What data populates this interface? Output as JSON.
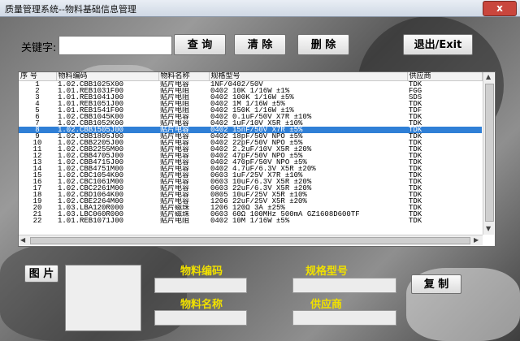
{
  "window": {
    "title": "质量管理系统--物料基础信息管理",
    "close": "x"
  },
  "search": {
    "label": "关键字:",
    "value": ""
  },
  "buttons": {
    "search": "查 询",
    "clear": "清 除",
    "delete": "删 除",
    "exit": "退出/Exit",
    "photo": "图 片",
    "copy": "复 制"
  },
  "table": {
    "headers": [
      "序 号",
      "物料编码",
      "物料名称",
      "规格型号",
      "供应商"
    ],
    "selected_index": 7,
    "rows": [
      [
        "1",
        "1.02.CBB1025X00",
        "贴片电容",
        "1NF/0402/50V",
        "TDK"
      ],
      [
        "2",
        "1.01.REB1031F00",
        "贴片电阻",
        "0402 10K 1/16W ±1%",
        "FGG"
      ],
      [
        "3",
        "1.01.REB1041J00",
        "贴片电阻",
        "0402 100K 1/16W ±5%",
        "SDS"
      ],
      [
        "4",
        "1.01.REB1051J00",
        "贴片电阻",
        "0402 1M 1/16W ±5%",
        "TDK"
      ],
      [
        "5",
        "1.01.REB1541F00",
        "贴片电阻",
        "0402 150K 1/16W ±1%",
        "TDF"
      ],
      [
        "6",
        "1.02.CBB1045K00",
        "贴片电容",
        "0402 0.1uF/50V X7R ±10%",
        "TDK"
      ],
      [
        "7",
        "1.02.CBB1052K00",
        "贴片电容",
        "0402 1uF/10V X5R ±10%",
        "TDK"
      ],
      [
        "8",
        "1.02.CBB1505J00",
        "贴片电容",
        "0402 15nF/50V X7R ±5%",
        "TDK"
      ],
      [
        "9",
        "1.02.CBB1805J00",
        "贴片电容",
        "0402 18pF/50V NPO ±5%",
        "TDK"
      ],
      [
        "10",
        "1.02.CBB2205J00",
        "贴片电容",
        "0402 22pF/50V NPO ±5%",
        "TDK"
      ],
      [
        "11",
        "1.02.CBB2255M00",
        "贴片电容",
        "0402 2.2uF/10V X5R ±20%",
        "TDK"
      ],
      [
        "12",
        "1.02.CBB4705J00",
        "贴片电容",
        "0402 47pF/50V NPO ±5%",
        "TDK"
      ],
      [
        "13",
        "1.02.CBB4715J00",
        "贴片电容",
        "0402 470pF/50V NPO ±5%",
        "TDK"
      ],
      [
        "14",
        "1.02.CBB4751M00",
        "贴片电容",
        "0402 4.7uF/6.3V X5R ±20%",
        "TDK"
      ],
      [
        "15",
        "1.02.CBC1054K00",
        "贴片电容",
        "0603 1uF/25V X7R ±10%",
        "TDK"
      ],
      [
        "16",
        "1.02.CBC1061M00",
        "贴片电容",
        "0603 10uF/6.3V X5R ±20%",
        "TDK"
      ],
      [
        "17",
        "1.02.CBC2261M00",
        "贴片电容",
        "0603 22uF/6.3V X5R ±20%",
        "TDK"
      ],
      [
        "18",
        "1.02.CBD1064K00",
        "贴片电容",
        "0805 10uF/25V X5R ±10%",
        "TDK"
      ],
      [
        "19",
        "1.02.CBE2264M00",
        "贴片电容",
        "1206 22uF/25V X5R ±20%",
        "TDK"
      ],
      [
        "20",
        "1.03.LBA120R000",
        "贴片磁珠",
        "1206 120Ω  3A ±25%",
        "TDK"
      ],
      [
        "21",
        "1.03.LBC060R000",
        "贴片磁珠",
        "0603 60Ω 100MHz 500mA GZ1608D600TF",
        "TDK"
      ],
      [
        "22",
        "1.01.REB1071J00",
        "贴片电阻",
        "0402 10M 1/16W ±5%",
        "TDK"
      ]
    ]
  },
  "form": {
    "code_label": "物料编码",
    "spec_label": "规格型号",
    "name_label": "物料名称",
    "supplier_label": "供应商"
  }
}
